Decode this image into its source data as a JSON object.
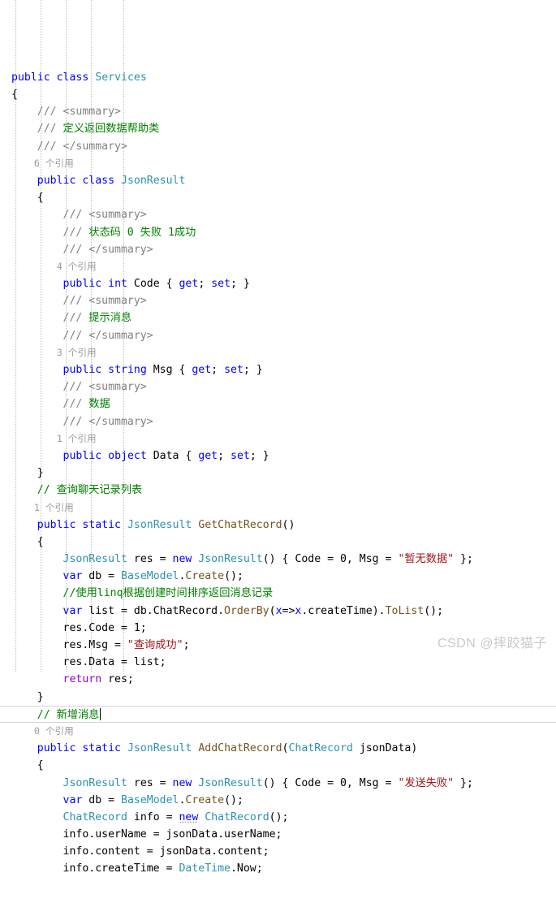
{
  "editor": {
    "language": "csharp",
    "theme": "visual-studio-light",
    "background_color": "#ffffff",
    "colors": {
      "keyword": "#0000FF",
      "control_keyword": "#8F08C4",
      "type": "#2B91AF",
      "method": "#74531F",
      "string": "#A31515",
      "comment": "#008000",
      "xml_doc_tag": "#808080",
      "codelens": "#9A9A9A",
      "plain_text": "#000000",
      "indent_guide": "#BFBFBF",
      "current_line_border": "#D4D4D4"
    },
    "guides_x": [
      19,
      50,
      81,
      112,
      152
    ],
    "current_line_index": 33,
    "caret_line_index": 33
  },
  "watermark": {
    "text": "CSDN @摔跤猫子"
  },
  "lines": [
    {
      "n": 0,
      "tokens": [
        {
          "t": "public",
          "c": "kw"
        },
        {
          "t": " ",
          "c": "plain"
        },
        {
          "t": "class",
          "c": "kw"
        },
        {
          "t": " ",
          "c": "plain"
        },
        {
          "t": "Services",
          "c": "type"
        }
      ]
    },
    {
      "n": 1,
      "tokens": [
        {
          "t": "{",
          "c": "plain"
        }
      ]
    },
    {
      "n": 2,
      "tokens": [
        {
          "t": "    /// ",
          "c": "xdoc"
        },
        {
          "t": "<summary>",
          "c": "xdoc"
        }
      ]
    },
    {
      "n": 3,
      "tokens": [
        {
          "t": "    /// ",
          "c": "xdoc"
        },
        {
          "t": "定义返回数据帮助类",
          "c": "cmt"
        }
      ]
    },
    {
      "n": 4,
      "tokens": [
        {
          "t": "    /// ",
          "c": "xdoc"
        },
        {
          "t": "</summary>",
          "c": "xdoc"
        }
      ]
    },
    {
      "n": 5,
      "tokens": [
        {
          "t": "    6 个引用",
          "c": "lens"
        }
      ]
    },
    {
      "n": 6,
      "tokens": [
        {
          "t": "    ",
          "c": "plain"
        },
        {
          "t": "public",
          "c": "kw"
        },
        {
          "t": " ",
          "c": "plain"
        },
        {
          "t": "class",
          "c": "kw"
        },
        {
          "t": " ",
          "c": "plain"
        },
        {
          "t": "JsonResult",
          "c": "type"
        }
      ]
    },
    {
      "n": 7,
      "tokens": [
        {
          "t": "    {",
          "c": "plain"
        }
      ]
    },
    {
      "n": 8,
      "tokens": [
        {
          "t": "        /// ",
          "c": "xdoc"
        },
        {
          "t": "<summary>",
          "c": "xdoc"
        }
      ]
    },
    {
      "n": 9,
      "tokens": [
        {
          "t": "        /// ",
          "c": "xdoc"
        },
        {
          "t": "状态码 0 失败 1成功",
          "c": "cmt"
        }
      ]
    },
    {
      "n": 10,
      "tokens": [
        {
          "t": "        /// ",
          "c": "xdoc"
        },
        {
          "t": "</summary>",
          "c": "xdoc"
        }
      ]
    },
    {
      "n": 11,
      "tokens": [
        {
          "t": "        4 个引用",
          "c": "lens"
        }
      ]
    },
    {
      "n": 12,
      "tokens": [
        {
          "t": "        ",
          "c": "plain"
        },
        {
          "t": "public",
          "c": "kw"
        },
        {
          "t": " ",
          "c": "plain"
        },
        {
          "t": "int",
          "c": "kw"
        },
        {
          "t": " Code { ",
          "c": "plain"
        },
        {
          "t": "get",
          "c": "kw"
        },
        {
          "t": "; ",
          "c": "plain"
        },
        {
          "t": "set",
          "c": "kw"
        },
        {
          "t": "; }",
          "c": "plain"
        }
      ]
    },
    {
      "n": 13,
      "tokens": [
        {
          "t": "        /// ",
          "c": "xdoc"
        },
        {
          "t": "<summary>",
          "c": "xdoc"
        }
      ]
    },
    {
      "n": 14,
      "tokens": [
        {
          "t": "        /// ",
          "c": "xdoc"
        },
        {
          "t": "提示消息",
          "c": "cmt"
        }
      ]
    },
    {
      "n": 15,
      "tokens": [
        {
          "t": "        /// ",
          "c": "xdoc"
        },
        {
          "t": "</summary>",
          "c": "xdoc"
        }
      ]
    },
    {
      "n": 16,
      "tokens": [
        {
          "t": "        3 个引用",
          "c": "lens"
        }
      ]
    },
    {
      "n": 17,
      "tokens": [
        {
          "t": "        ",
          "c": "plain"
        },
        {
          "t": "public",
          "c": "kw"
        },
        {
          "t": " ",
          "c": "plain"
        },
        {
          "t": "string",
          "c": "kw"
        },
        {
          "t": " Msg { ",
          "c": "plain"
        },
        {
          "t": "get",
          "c": "kw"
        },
        {
          "t": "; ",
          "c": "plain"
        },
        {
          "t": "set",
          "c": "kw"
        },
        {
          "t": "; }",
          "c": "plain"
        }
      ]
    },
    {
      "n": 18,
      "tokens": [
        {
          "t": "        /// ",
          "c": "xdoc"
        },
        {
          "t": "<summary>",
          "c": "xdoc"
        }
      ]
    },
    {
      "n": 19,
      "tokens": [
        {
          "t": "        /// ",
          "c": "xdoc"
        },
        {
          "t": "数据",
          "c": "cmt"
        }
      ]
    },
    {
      "n": 20,
      "tokens": [
        {
          "t": "        /// ",
          "c": "xdoc"
        },
        {
          "t": "</summary>",
          "c": "xdoc"
        }
      ]
    },
    {
      "n": 21,
      "tokens": [
        {
          "t": "        1 个引用",
          "c": "lens"
        }
      ]
    },
    {
      "n": 22,
      "tokens": [
        {
          "t": "        ",
          "c": "plain"
        },
        {
          "t": "public",
          "c": "kw"
        },
        {
          "t": " ",
          "c": "plain"
        },
        {
          "t": "object",
          "c": "kw"
        },
        {
          "t": " Data { ",
          "c": "plain"
        },
        {
          "t": "get",
          "c": "kw"
        },
        {
          "t": "; ",
          "c": "plain"
        },
        {
          "t": "set",
          "c": "kw"
        },
        {
          "t": "; }",
          "c": "plain"
        }
      ]
    },
    {
      "n": 23,
      "tokens": [
        {
          "t": "    }",
          "c": "plain"
        }
      ]
    },
    {
      "n": 24,
      "tokens": [
        {
          "t": "    // 查询聊天记录列表",
          "c": "cmt"
        }
      ]
    },
    {
      "n": 25,
      "tokens": [
        {
          "t": "    1 个引用",
          "c": "lens"
        }
      ]
    },
    {
      "n": 26,
      "tokens": [
        {
          "t": "    ",
          "c": "plain"
        },
        {
          "t": "public",
          "c": "kw"
        },
        {
          "t": " ",
          "c": "plain"
        },
        {
          "t": "static",
          "c": "kw"
        },
        {
          "t": " ",
          "c": "plain"
        },
        {
          "t": "JsonResult",
          "c": "type"
        },
        {
          "t": " ",
          "c": "plain"
        },
        {
          "t": "GetChatRecord",
          "c": "meth"
        },
        {
          "t": "()",
          "c": "plain"
        }
      ]
    },
    {
      "n": 27,
      "tokens": [
        {
          "t": "    {",
          "c": "plain"
        }
      ]
    },
    {
      "n": 28,
      "tokens": [
        {
          "t": "        ",
          "c": "plain"
        },
        {
          "t": "JsonResult",
          "c": "type"
        },
        {
          "t": " res = ",
          "c": "plain"
        },
        {
          "t": "new",
          "c": "kw"
        },
        {
          "t": " ",
          "c": "plain"
        },
        {
          "t": "JsonResult",
          "c": "type"
        },
        {
          "t": "() { Code = 0, Msg = ",
          "c": "plain"
        },
        {
          "t": "\"暂无数据\"",
          "c": "str"
        },
        {
          "t": " };",
          "c": "plain"
        }
      ]
    },
    {
      "n": 29,
      "tokens": [
        {
          "t": "        ",
          "c": "plain"
        },
        {
          "t": "var",
          "c": "kw"
        },
        {
          "t": " db = ",
          "c": "plain"
        },
        {
          "t": "BaseModel",
          "c": "type"
        },
        {
          "t": ".",
          "c": "plain"
        },
        {
          "t": "Create",
          "c": "meth"
        },
        {
          "t": "();",
          "c": "plain"
        }
      ]
    },
    {
      "n": 30,
      "tokens": [
        {
          "t": "        //使用linq根据创建时间排序返回消息记录",
          "c": "cmt"
        }
      ]
    },
    {
      "n": 31,
      "tokens": [
        {
          "t": "        ",
          "c": "plain"
        },
        {
          "t": "var",
          "c": "kw"
        },
        {
          "t": " list = db.ChatRecord.",
          "c": "plain"
        },
        {
          "t": "OrderBy",
          "c": "meth"
        },
        {
          "t": "(",
          "c": "plain"
        },
        {
          "t": "x",
          "c": "kw"
        },
        {
          "t": "=>",
          "c": "plain"
        },
        {
          "t": "x",
          "c": "kw"
        },
        {
          "t": ".createTime).",
          "c": "plain"
        },
        {
          "t": "ToList",
          "c": "meth"
        },
        {
          "t": "();",
          "c": "plain"
        }
      ]
    },
    {
      "n": 32,
      "tokens": [
        {
          "t": "        res.Code = 1;",
          "c": "plain"
        }
      ]
    },
    {
      "n": 33,
      "tokens": [
        {
          "t": "        res.Msg = ",
          "c": "plain"
        },
        {
          "t": "\"查询成功\"",
          "c": "str"
        },
        {
          "t": ";",
          "c": "plain"
        }
      ]
    },
    {
      "n": 34,
      "tokens": [
        {
          "t": "        res.Data = list;",
          "c": "plain"
        }
      ]
    },
    {
      "n": 35,
      "tokens": [
        {
          "t": "        ",
          "c": "plain"
        },
        {
          "t": "return",
          "c": "ret"
        },
        {
          "t": " res;",
          "c": "plain"
        }
      ]
    },
    {
      "n": 36,
      "tokens": [
        {
          "t": "    }",
          "c": "plain"
        }
      ]
    },
    {
      "n": 37,
      "tokens": [
        {
          "t": "    // 新增消息",
          "c": "cmt"
        },
        {
          "t": "",
          "c": "caret"
        }
      ]
    },
    {
      "n": 38,
      "tokens": [
        {
          "t": "    0 个引用",
          "c": "lens"
        }
      ]
    },
    {
      "n": 39,
      "tokens": [
        {
          "t": "    ",
          "c": "plain"
        },
        {
          "t": "public",
          "c": "kw"
        },
        {
          "t": " ",
          "c": "plain"
        },
        {
          "t": "static",
          "c": "kw"
        },
        {
          "t": " ",
          "c": "plain"
        },
        {
          "t": "JsonResult",
          "c": "type"
        },
        {
          "t": " ",
          "c": "plain"
        },
        {
          "t": "AddChatRecord",
          "c": "meth"
        },
        {
          "t": "(",
          "c": "plain"
        },
        {
          "t": "ChatRecord",
          "c": "type"
        },
        {
          "t": " jsonData)",
          "c": "plain"
        }
      ]
    },
    {
      "n": 40,
      "tokens": [
        {
          "t": "    {",
          "c": "plain"
        }
      ]
    },
    {
      "n": 41,
      "tokens": [
        {
          "t": "        ",
          "c": "plain"
        },
        {
          "t": "JsonResult",
          "c": "type"
        },
        {
          "t": " res = ",
          "c": "plain"
        },
        {
          "t": "new",
          "c": "kw"
        },
        {
          "t": " ",
          "c": "plain"
        },
        {
          "t": "JsonResult",
          "c": "type"
        },
        {
          "t": "() { Code = 0, Msg = ",
          "c": "plain"
        },
        {
          "t": "\"发送失败\"",
          "c": "str"
        },
        {
          "t": " };",
          "c": "plain"
        }
      ]
    },
    {
      "n": 42,
      "tokens": [
        {
          "t": "        ",
          "c": "plain"
        },
        {
          "t": "var",
          "c": "kw"
        },
        {
          "t": " db = ",
          "c": "plain"
        },
        {
          "t": "BaseModel",
          "c": "type"
        },
        {
          "t": ".",
          "c": "plain"
        },
        {
          "t": "Create",
          "c": "meth"
        },
        {
          "t": "();",
          "c": "plain"
        }
      ]
    },
    {
      "n": 43,
      "tokens": [
        {
          "t": "        ",
          "c": "plain"
        },
        {
          "t": "ChatRecord",
          "c": "type"
        },
        {
          "t": " info = ",
          "c": "plain"
        },
        {
          "t": "new",
          "c": "kw squig"
        },
        {
          "t": " ",
          "c": "plain"
        },
        {
          "t": "ChatRecord",
          "c": "type"
        },
        {
          "t": "();",
          "c": "plain"
        }
      ]
    },
    {
      "n": 44,
      "tokens": [
        {
          "t": "        info.userName = jsonData.userName;",
          "c": "plain"
        }
      ]
    },
    {
      "n": 45,
      "tokens": [
        {
          "t": "        info.content = jsonData.content;",
          "c": "plain"
        }
      ]
    },
    {
      "n": 46,
      "tokens": [
        {
          "t": "        info.createTime = ",
          "c": "plain"
        },
        {
          "t": "DateTime",
          "c": "type"
        },
        {
          "t": ".Now;",
          "c": "plain"
        }
      ]
    }
  ]
}
